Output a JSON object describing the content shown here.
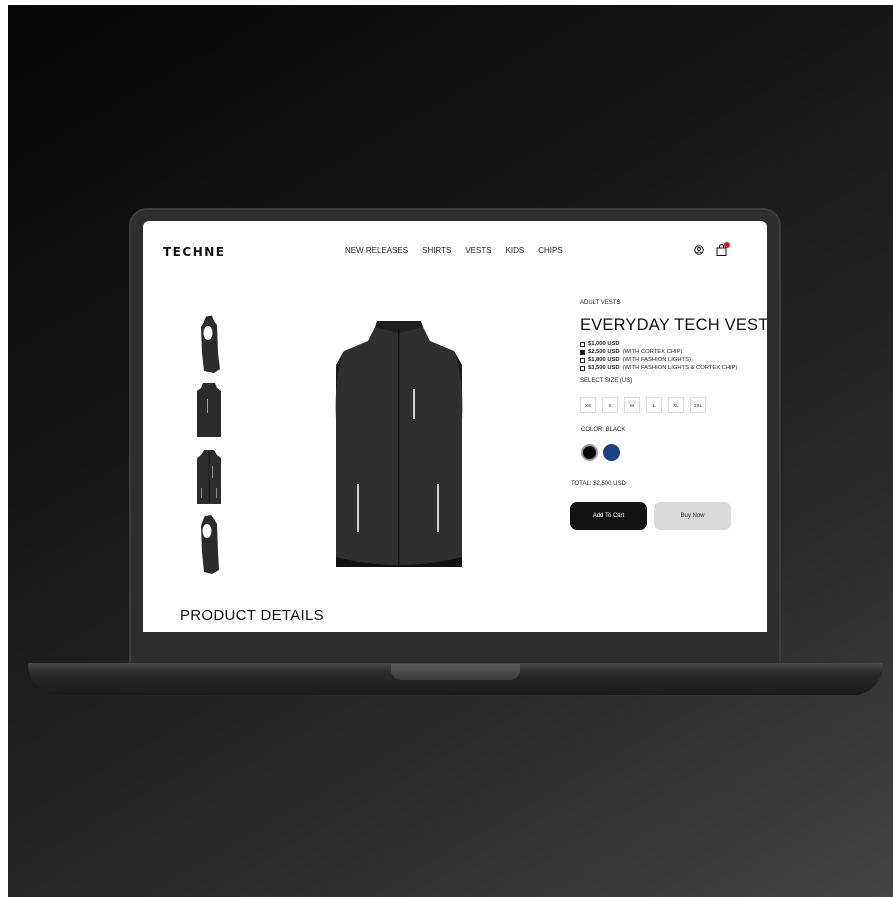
{
  "brand": "TECHNE",
  "nav": [
    "NEW RELEASES",
    "SHIRTS",
    "VESTS",
    "KIDS",
    "CHIPS"
  ],
  "product": {
    "category": "ADULT VESTS",
    "title": "EVERYDAY TECH VEST",
    "options": [
      {
        "price": "$1,000 USD",
        "note": "",
        "selected": false
      },
      {
        "price": "$2,500 USD",
        "note": "(WITH CORTEX CHIP)",
        "selected": true
      },
      {
        "price": "$1,800 USD",
        "note": "(WITH FASHION LIGHTS)",
        "selected": false
      },
      {
        "price": "$3,500 USD",
        "note": "(WITH FASHION LIGHTS & CORTEX CHIP)",
        "selected": false
      }
    ],
    "size_label": "SELECT SIZE (US)",
    "sizes": [
      "XS",
      "S",
      "M",
      "L",
      "XL",
      "2XL"
    ],
    "color_label": "COLOR: BLACK",
    "colors": [
      "#050505",
      "#1f3f88"
    ],
    "total": "TOTAL: $2,500 USD",
    "add_to_cart": "Add To Cart",
    "buy_now": "Buy Now"
  },
  "details_heading": "PRODUCT DETAILS",
  "cart_badge_color": "#e0141e"
}
